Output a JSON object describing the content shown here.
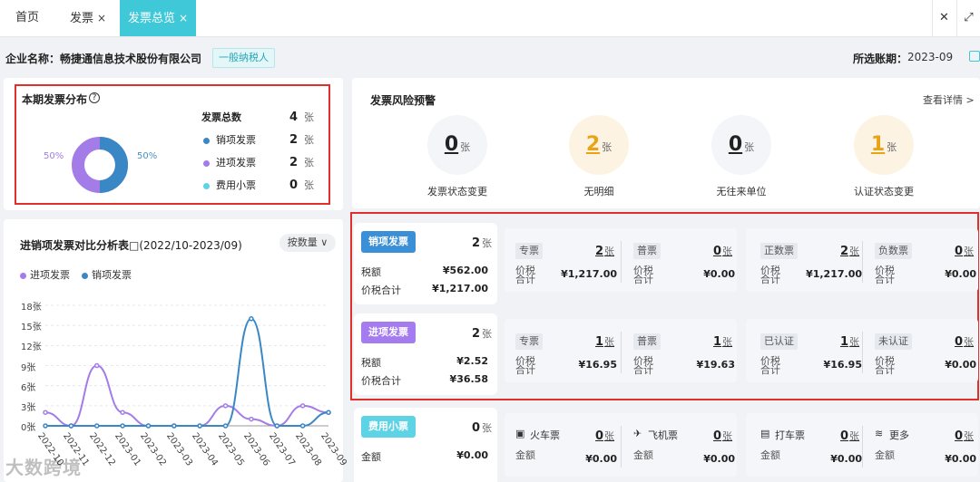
{
  "tabs": [
    {
      "label": "首页"
    },
    {
      "label": "发票",
      "close": "×"
    },
    {
      "label": "发票总览",
      "close": "×"
    }
  ],
  "window": {
    "close": "✕",
    "expand": "⤢"
  },
  "header": {
    "company_label": "企业名称：畅捷通信息技术股份有限公司",
    "taxpayer_tag": "一般纳税人",
    "period_label": "所选账期：",
    "period_value": "2023-09"
  },
  "distribution": {
    "title": "本期发票分布",
    "help": "?",
    "total_label": "发票总数",
    "total_value": "4",
    "unit": "张",
    "pct_left": "50%",
    "pct_right": "50%",
    "items": [
      {
        "label": "销项发票",
        "value": "2",
        "color": "#3a87c6"
      },
      {
        "label": "进项发票",
        "value": "2",
        "color": "#a47ce8"
      },
      {
        "label": "费用小票",
        "value": "0",
        "color": "#5ad4e6"
      }
    ]
  },
  "risk": {
    "title": "发票风险预警",
    "more": "查看详情 >",
    "items": [
      {
        "value": "0",
        "unit": "张",
        "label": "发票状态变更",
        "bg": "#f3f5f8",
        "color": "#222"
      },
      {
        "value": "2",
        "unit": "张",
        "label": "无明细",
        "bg": "#fdf3e3",
        "color": "#e8a317"
      },
      {
        "value": "0",
        "unit": "张",
        "label": "无往来单位",
        "bg": "#f3f5f8",
        "color": "#222"
      },
      {
        "value": "1",
        "unit": "张",
        "label": "认证状态变更",
        "bg": "#fdf3e3",
        "color": "#e8a317"
      }
    ]
  },
  "compare": {
    "title": "进销项发票对比分析表",
    "range": "(2022/10-2023/09)",
    "by_count": "按数量",
    "legend_in": "进项发票",
    "legend_out": "销项发票"
  },
  "chart_data": {
    "type": "line",
    "categories": [
      "2022-10",
      "2022-11",
      "2022-12",
      "2023-01",
      "2023-02",
      "2023-03",
      "2023-04",
      "2023-05",
      "2023-06",
      "2023-07",
      "2023-08",
      "2023-09"
    ],
    "series": [
      {
        "name": "进项发票",
        "color": "#a47ce8",
        "values": [
          2,
          0,
          9,
          2,
          0,
          0,
          0,
          3,
          1,
          0,
          3,
          2
        ]
      },
      {
        "name": "销项发票",
        "color": "#3a87c6",
        "values": [
          0,
          0,
          0,
          0,
          0,
          0,
          0,
          0,
          16,
          0,
          0,
          2
        ]
      }
    ],
    "y_ticks": [
      "0张",
      "3张",
      "6张",
      "9张",
      "12张",
      "15张",
      "18张"
    ],
    "x_ticks": [
      "2022-10",
      "2022-11",
      "2022-12",
      "2023-01",
      "2023-02",
      "2023-03",
      "2023-04",
      "2023-05",
      "2023-06",
      "2023-07",
      "2023-08",
      "2023-09"
    ],
    "ylim": [
      0,
      18
    ],
    "grid": true,
    "legend": "top-left"
  },
  "rows": [
    {
      "badge": "销项发票",
      "badge_color": "#3a8fd6",
      "count": "2",
      "unit": "张",
      "tax_label": "税额",
      "tax_value": "¥562.00",
      "total_label": "价税合计",
      "total_value": "¥1,217.00",
      "subs": [
        {
          "chip": "专票",
          "count": "2",
          "label": "价税\n合计",
          "value": "¥1,217.00"
        },
        {
          "chip": "普票",
          "count": "0",
          "label": "价税\n合计",
          "value": "¥0.00"
        },
        {
          "chip": "正数票",
          "count": "2",
          "label": "价税\n合计",
          "value": "¥1,217.00"
        },
        {
          "chip": "负数票",
          "count": "0",
          "label": "价税\n合计",
          "value": "¥0.00"
        }
      ]
    },
    {
      "badge": "进项发票",
      "badge_color": "#a57cf0",
      "count": "2",
      "unit": "张",
      "tax_label": "税额",
      "tax_value": "¥2.52",
      "total_label": "价税合计",
      "total_value": "¥36.58",
      "subs": [
        {
          "chip": "专票",
          "count": "1",
          "label": "价税\n合计",
          "value": "¥16.95"
        },
        {
          "chip": "普票",
          "count": "1",
          "label": "价税\n合计",
          "value": "¥19.63"
        },
        {
          "chip": "已认证",
          "count": "1",
          "label": "价税\n合计",
          "value": "¥16.95"
        },
        {
          "chip": "未认证",
          "count": "0",
          "label": "价税\n合计",
          "value": "¥0.00"
        }
      ]
    },
    {
      "badge": "费用小票",
      "badge_color": "#5fd3e6",
      "count": "0",
      "unit": "张",
      "amount_label": "金额",
      "amount_value": "¥0.00",
      "subs": [
        {
          "chip": "火车票",
          "icon": "train-icon",
          "count": "0",
          "label": "金额",
          "value": "¥0.00"
        },
        {
          "chip": "飞机票",
          "icon": "plane-icon",
          "count": "0",
          "label": "金额",
          "value": "¥0.00"
        },
        {
          "chip": "打车票",
          "icon": "car-icon",
          "count": "0",
          "label": "金额",
          "value": "¥0.00"
        },
        {
          "chip": "更多",
          "icon": "layers-icon",
          "count": "0",
          "label": "金额",
          "value": "¥0.00"
        }
      ]
    }
  ],
  "watermark": "大数跨境"
}
